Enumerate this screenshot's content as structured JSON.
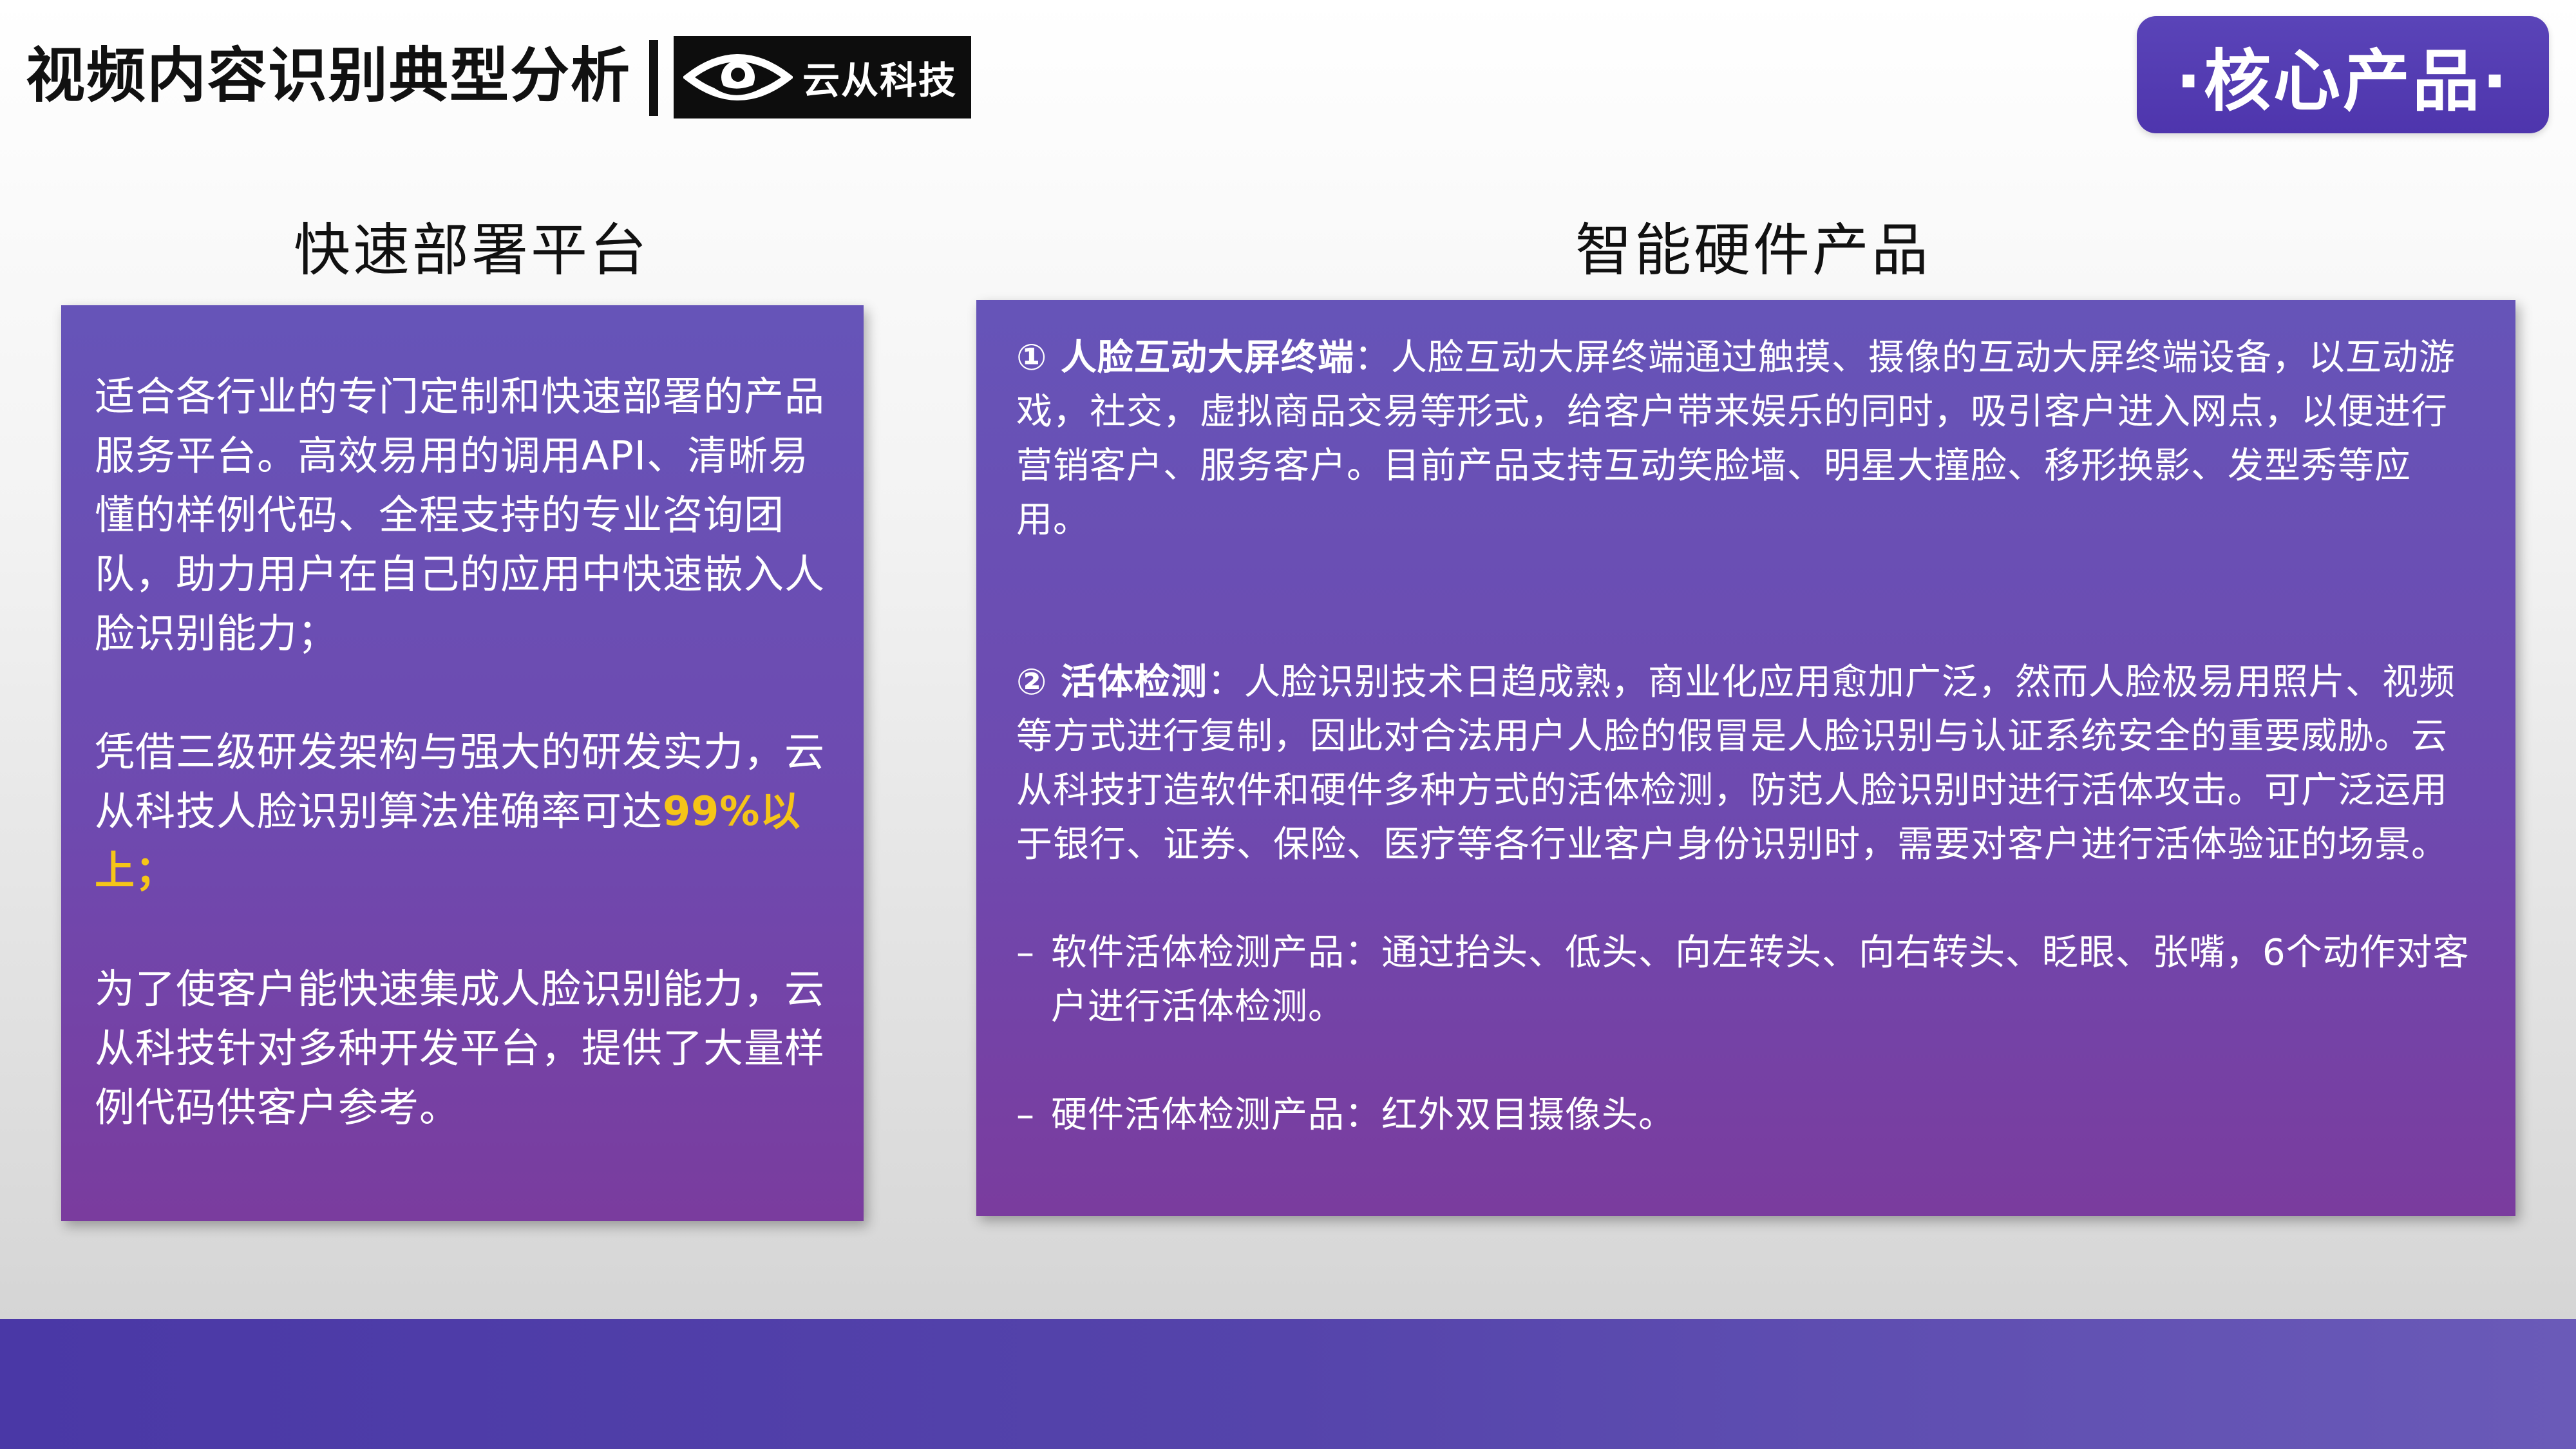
{
  "header": {
    "title": "视频内容识别典型分析",
    "logo_text": "云从科技",
    "badge": "·核心产品·"
  },
  "left": {
    "heading": "快速部署平台",
    "para1": "适合各行业的专门定制和快速部署的产品服务平台。高效易用的调用API、清晰易懂的样例代码、全程支持的专业咨询团队，助力用户在自己的应用中快速嵌入人脸识别能力；",
    "para2_text": "凭借三级研发架构与强大的研发实力，云从科技人脸识别算法准确率可达",
    "para2_highlight": "99%以上；",
    "para3": "为了使客户能快速集成人脸识别能力，云从科技针对多种开发平台，提供了大量样例代码供客户参考。"
  },
  "right": {
    "heading": "智能硬件产品",
    "item1_label": "① 人脸互动大屏终端",
    "item1_text": "：人脸互动大屏终端通过触摸、摄像的互动大屏终端设备，以互动游戏，社交，虚拟商品交易等形式，给客户带来娱乐的同时，吸引客户进入网点，以便进行营销客户、服务客户。目前产品支持互动笑脸墙、明星大撞脸、移形换影、发型秀等应用。",
    "item2_label": "② 活体检测",
    "item2_text": "：人脸识别技术日趋成熟，商业化应用愈加广泛，然而人脸极易用照片、视频等方式进行复制，因此对合法用户人脸的假冒是人脸识别与认证系统安全的重要威胁。云从科技打造软件和硬件多种方式的活体检测，防范人脸识别时进行活体攻击。可广泛运用于银行、证券、保险、医疗等各行业客户身份识别时，需要对客户进行活体验证的场景。",
    "bullet_marker": "–",
    "bullet1": "软件活体检测产品：通过抬头、低头、向左转头、向右转头、眨眼、张嘴，6个动作对客户进行活体检测。",
    "bullet2": "硬件活体检测产品：红外双目摄像头。"
  },
  "colors": {
    "accent": "#4e35ad",
    "card_top": "#6654b8",
    "card_bottom": "#7a3c9e",
    "highlight": "#f5c518"
  }
}
